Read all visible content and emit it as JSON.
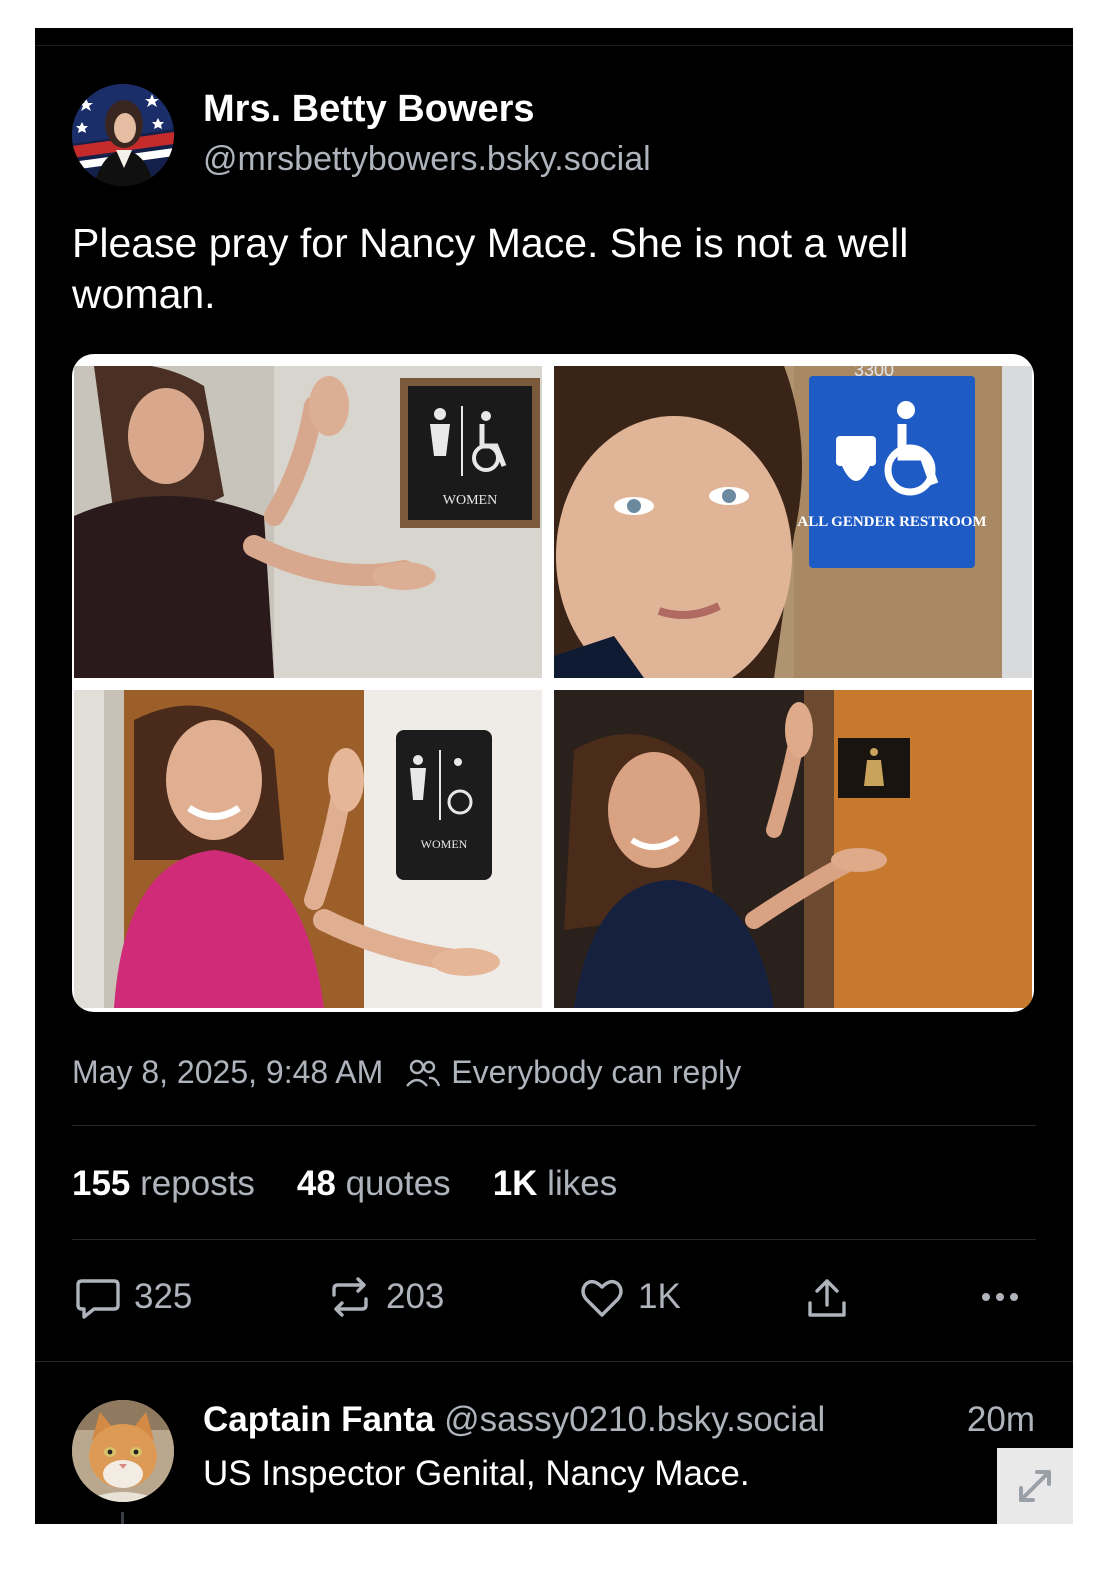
{
  "post": {
    "author_name": "Mrs. Betty Bowers",
    "author_handle": "@mrsbettybowers.bsky.social",
    "text": "Please pray for Nancy Mace. She is not a well woman.",
    "images": [
      {
        "sign_text": "WOMEN"
      },
      {
        "sign_text": "ALL GENDER RESTROOM",
        "room_number": "3300"
      },
      {
        "sign_text": "WOMEN"
      },
      {
        "sign_text": ""
      }
    ],
    "timestamp": "May 8, 2025, 9:48 AM",
    "reply_setting": "Everybody can reply",
    "stats": {
      "reposts_count": "155",
      "reposts_label": "reposts",
      "quotes_count": "48",
      "quotes_label": "quotes",
      "likes_count": "1K",
      "likes_label": "likes"
    },
    "actions": {
      "reply_count": "325",
      "repost_count": "203",
      "like_count": "1K"
    }
  },
  "reply": {
    "author_name": "Captain Fanta",
    "author_handle": "@sassy0210.bsky.social",
    "time": "20m",
    "text": "US Inspector Genital, Nancy Mace."
  },
  "icons": {
    "reply": "speech-bubble-icon",
    "repost": "repost-arrows-icon",
    "like": "heart-icon",
    "share": "share-upload-icon",
    "more": "ellipsis-icon",
    "expand": "expand-arrows-icon",
    "audience": "people-icon"
  },
  "colors": {
    "background": "#000000",
    "text_primary": "#ffffff",
    "text_secondary": "#aeb3bc",
    "sign_blue": "#1f5bc4"
  }
}
